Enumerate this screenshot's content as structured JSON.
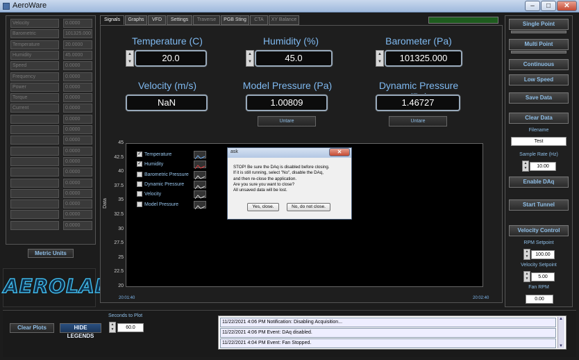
{
  "window": {
    "title": "AeroWare"
  },
  "left_readouts": [
    {
      "name": "Velocity",
      "value": "0.0000"
    },
    {
      "name": "Barometric",
      "value": "101325.000"
    },
    {
      "name": "Temperature",
      "value": "20.0000"
    },
    {
      "name": "Humidity",
      "value": "45.0000"
    },
    {
      "name": "Speed",
      "value": "0.0000"
    },
    {
      "name": "Frequency",
      "value": "0.0000"
    },
    {
      "name": "Power",
      "value": "0.0000"
    },
    {
      "name": "Torque",
      "value": "0.0000"
    },
    {
      "name": "Current",
      "value": "0.0000"
    },
    {
      "name": "",
      "value": "0.0000"
    },
    {
      "name": "",
      "value": "0.0000"
    },
    {
      "name": "",
      "value": "0.0000"
    },
    {
      "name": "",
      "value": "0.0000"
    },
    {
      "name": "",
      "value": "0.0000"
    },
    {
      "name": "",
      "value": "0.0000"
    },
    {
      "name": "",
      "value": "0.0000"
    },
    {
      "name": "",
      "value": "0.0000"
    },
    {
      "name": "",
      "value": "0.0000"
    },
    {
      "name": "",
      "value": "0.0000"
    },
    {
      "name": "",
      "value": "0.0000"
    }
  ],
  "metric_units_label": "Metric Units",
  "logo_text": "AEROLAB",
  "tabs": [
    {
      "label": "Signals",
      "state": "active"
    },
    {
      "label": "Graphs",
      "state": "normal"
    },
    {
      "label": "VFD",
      "state": "normal"
    },
    {
      "label": "Settings",
      "state": "normal"
    },
    {
      "label": "Traverse",
      "state": "disabled"
    },
    {
      "label": "PGB Sting",
      "state": "normal"
    },
    {
      "label": "CTA",
      "state": "disabled"
    },
    {
      "label": "XY Balance",
      "state": "disabled"
    }
  ],
  "readouts": {
    "temperature": {
      "label": "Temperature (C)",
      "value": "20.0"
    },
    "humidity": {
      "label": "Humidity (%)",
      "value": "45.0"
    },
    "barometer": {
      "label": "Barometer (Pa)",
      "value": "101325.000"
    },
    "velocity": {
      "label": "Velocity (m/s)",
      "value": "NaN"
    },
    "model_pressure": {
      "label": "Model Pressure (Pa)",
      "value": "1.00809"
    },
    "dynamic_pressure": {
      "label": "Dynamic Pressure (Pa)",
      "value": "1.46727"
    },
    "untare_label": "Untare"
  },
  "chart_data": {
    "type": "line",
    "ylabel": "Data",
    "yticks": [
      "45",
      "42.5",
      "40",
      "37.5",
      "35",
      "32.5",
      "30",
      "27.5",
      "25",
      "22.5",
      "20"
    ],
    "ylim": [
      20,
      45
    ],
    "xticks": [
      "20:01:40",
      "20:02:40"
    ],
    "series": [
      {
        "name": "Temperature",
        "checked": true,
        "color": "#6aa8e8"
      },
      {
        "name": "Humidity",
        "checked": true,
        "color": "#e04040"
      },
      {
        "name": "Barometric Pressure",
        "checked": false,
        "color": "#d0d0d0"
      },
      {
        "name": "Dynamic Pressure",
        "checked": false,
        "color": "#d0d0d0"
      },
      {
        "name": "Velocity",
        "checked": false,
        "color": "#d0d0d0"
      },
      {
        "name": "Model Pressure",
        "checked": false,
        "color": "#d0d0d0"
      }
    ]
  },
  "dialog": {
    "title": "ask",
    "close_glyph": "✕",
    "lines": [
      "STOP! Be sure the DAq is disabled before closing.",
      "If it is still running, select \"No\", disable the DAq,",
      "and then re-close the application.",
      "Are you sure you want to close?",
      "All unsaved data will be lost."
    ],
    "yes_label": "Yes, close.",
    "no_label": "No, do not close."
  },
  "right_panel": {
    "single_point": "Single Point",
    "multi_point": "Multi Point",
    "continuous": "Continuous",
    "low_speed": "Low Speed",
    "save_data": "Save Data",
    "clear_data": "Clear Data",
    "filename_label": "Filename",
    "filename_value": "Test",
    "sample_rate_label": "Sample Rate (Hz)",
    "sample_rate_value": "10.00",
    "enable_daq": "Enable DAq",
    "start_tunnel": "Start Tunnel",
    "velocity_control": "Velocity Control",
    "rpm_setpoint_label": "RPM Setpoint",
    "rpm_setpoint_value": "100.00",
    "velocity_setpoint_label": "Velocity Setpoint",
    "velocity_setpoint_value": "5.00",
    "fan_rpm_label": "Fan RPM",
    "fan_rpm_value": "0.00"
  },
  "bottom": {
    "clear_plots": "Clear Plots",
    "hide_legends": "HIDE LEGENDS",
    "seconds_label": "Seconds to Plot",
    "seconds_value": "60.0",
    "log": [
      "11/22/2021 4:06 PM Notification: Disabling Acquisition...",
      "11/22/2021 4:06 PM Event: DAq disabled.",
      "11/22/2021 4:04 PM Event: Fan Stopped."
    ]
  },
  "colors": {
    "accent": "#7fb9f0",
    "background": "#1c1c1c",
    "plot_bg": "#000000"
  }
}
